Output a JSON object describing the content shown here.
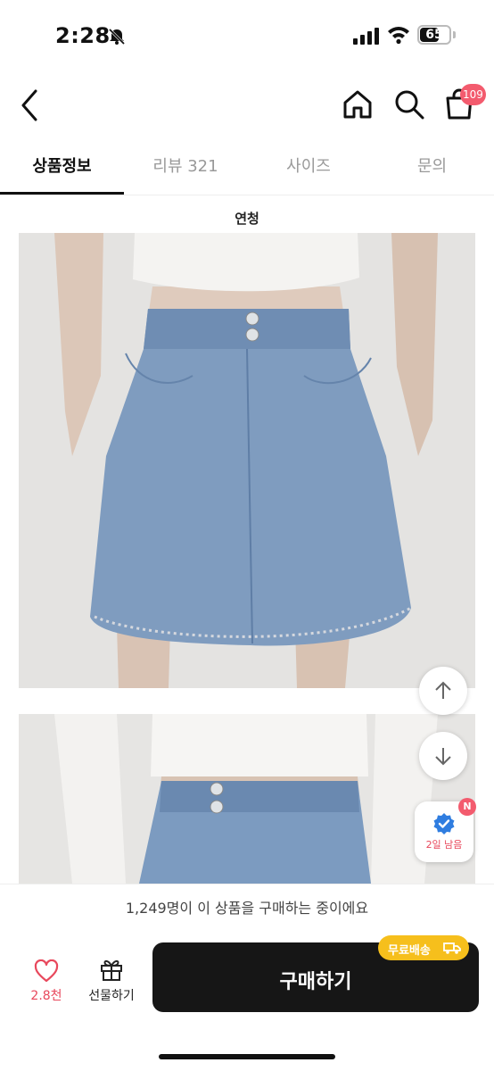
{
  "status_bar": {
    "time": "2:28",
    "battery": "65",
    "battery_level": 0.65
  },
  "nav": {
    "cart_badge": "109"
  },
  "tabs": [
    {
      "label": "상품정보",
      "active": true
    },
    {
      "label": "리뷰 321",
      "active": false
    },
    {
      "label": "사이즈",
      "active": false
    },
    {
      "label": "문의",
      "active": false
    }
  ],
  "content": {
    "caption": "연청"
  },
  "floating": {
    "coupon_badge": "N",
    "coupon_text": "2일 남음"
  },
  "buyers_bar": {
    "text": "1,249명이 이 상품을 구매하는 중이에요"
  },
  "bottom_bar": {
    "like_count": "2.8천",
    "gift_label": "선물하기",
    "buy_label": "구매하기",
    "free_shipping": "무료배송"
  },
  "colors": {
    "accent": "#f35b6e",
    "buy_button": "#161616",
    "free_shipping_badge": "#f6bf1c",
    "like": "#e8485c"
  }
}
